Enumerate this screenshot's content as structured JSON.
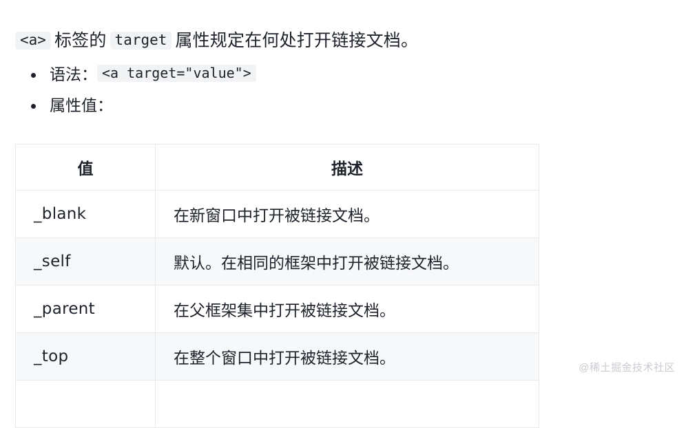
{
  "intro": {
    "code_tag": "<a>",
    "text_1": "标签的",
    "code_attr": "target",
    "text_2": "属性规定在何处打开链接文档。"
  },
  "bullets": [
    {
      "label": "语法：",
      "code": "<a target=\"value\">"
    },
    {
      "label": "属性值：",
      "code": ""
    }
  ],
  "table": {
    "headers": [
      "值",
      "描述"
    ],
    "rows": [
      {
        "value": "_blank",
        "description": "在新窗口中打开被链接文档。"
      },
      {
        "value": "_self",
        "description": "默认。在相同的框架中打开被链接文档。"
      },
      {
        "value": "_parent",
        "description": "在父框架集中打开被链接文档。"
      },
      {
        "value": "_top",
        "description": "在整个窗口中打开被链接文档。"
      },
      {
        "value": "",
        "description": ""
      }
    ]
  },
  "watermark": "@稀土掘金技术社区",
  "colors": {
    "text": "#1d2129",
    "code_background": "#f2f3f5",
    "table_border": "#e9eaec",
    "row_stripe": "#f7f8fa",
    "watermark": "#c9ccd1",
    "page_background": "#ffffff"
  }
}
